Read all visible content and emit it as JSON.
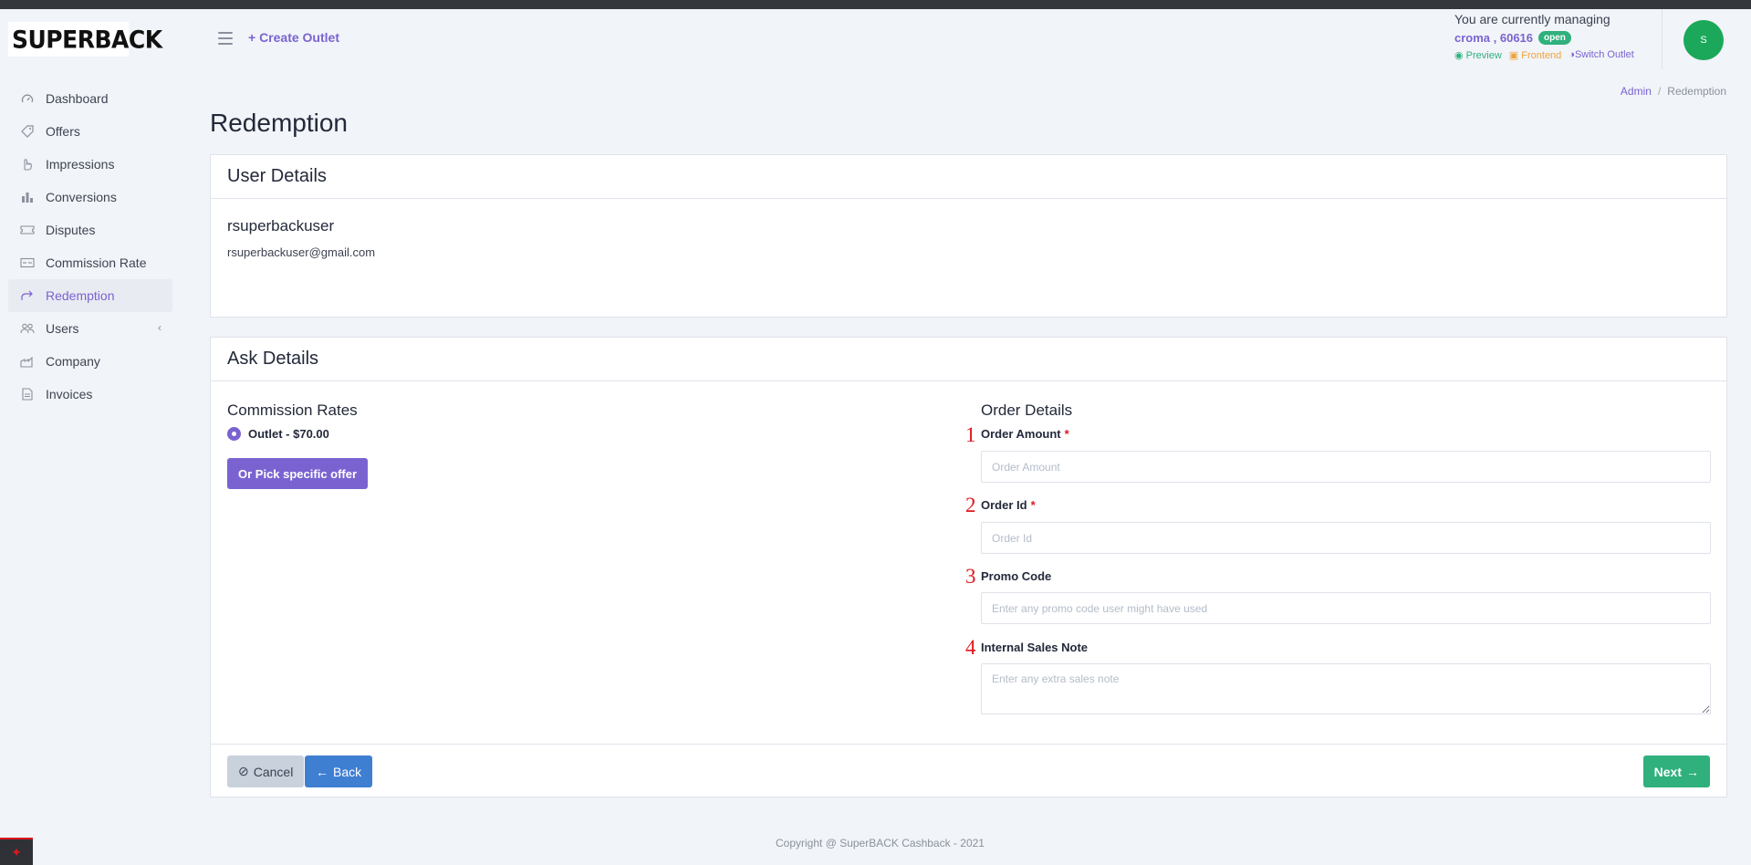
{
  "brand": {
    "logo_text": "SUPERBACK"
  },
  "sidebar": {
    "items": [
      {
        "label": "Dashboard",
        "icon": "gauge-icon"
      },
      {
        "label": "Offers",
        "icon": "tag-icon"
      },
      {
        "label": "Impressions",
        "icon": "pointer-hand-icon"
      },
      {
        "label": "Conversions",
        "icon": "bar-chart-icon"
      },
      {
        "label": "Disputes",
        "icon": "ticket-icon"
      },
      {
        "label": "Commission Rate",
        "icon": "card-icon"
      },
      {
        "label": "Redemption",
        "icon": "share-icon",
        "active": true
      },
      {
        "label": "Users",
        "icon": "users-icon",
        "expandable": true
      },
      {
        "label": "Company",
        "icon": "building-icon"
      },
      {
        "label": "Invoices",
        "icon": "document-icon"
      }
    ]
  },
  "header": {
    "create_outlet": "+ Create Outlet",
    "managing_label": "You are currently managing",
    "outlet_name": "croma , 60616",
    "outlet_status": "open",
    "preview": "Preview",
    "frontend": "Frontend",
    "switch_outlet": "Switch Outlet",
    "avatar_initial": "S"
  },
  "breadcrumb": {
    "root": "Admin",
    "current": "Redemption"
  },
  "page": {
    "title": "Redemption"
  },
  "user_details": {
    "title": "User Details",
    "name": "rsuperbackuser",
    "email": "rsuperbackuser@gmail.com"
  },
  "ask_details": {
    "title": "Ask Details",
    "commission_title": "Commission Rates",
    "commission_option": "Outlet - $70.00",
    "pick_offer_button": "Or Pick specific offer",
    "order_title": "Order Details",
    "fields": [
      {
        "number": "1",
        "label": "Order Amount",
        "required": "*",
        "placeholder": "Order Amount"
      },
      {
        "number": "2",
        "label": "Order Id",
        "required": "*",
        "placeholder": "Order Id"
      },
      {
        "number": "3",
        "label": "Promo Code",
        "placeholder": "Enter any promo code user might have used"
      },
      {
        "number": "4",
        "label": "Internal Sales Note",
        "placeholder": "Enter any extra sales note"
      }
    ],
    "cancel": "Cancel",
    "back": "Back",
    "next": "Next"
  },
  "footer": {
    "copyright": "Copyright @ SuperBACK Cashback - 2021"
  },
  "colors": {
    "accent": "#7a63d1",
    "success": "#2fb07c",
    "primary": "#3f7fd2",
    "required": "#e0161e"
  }
}
